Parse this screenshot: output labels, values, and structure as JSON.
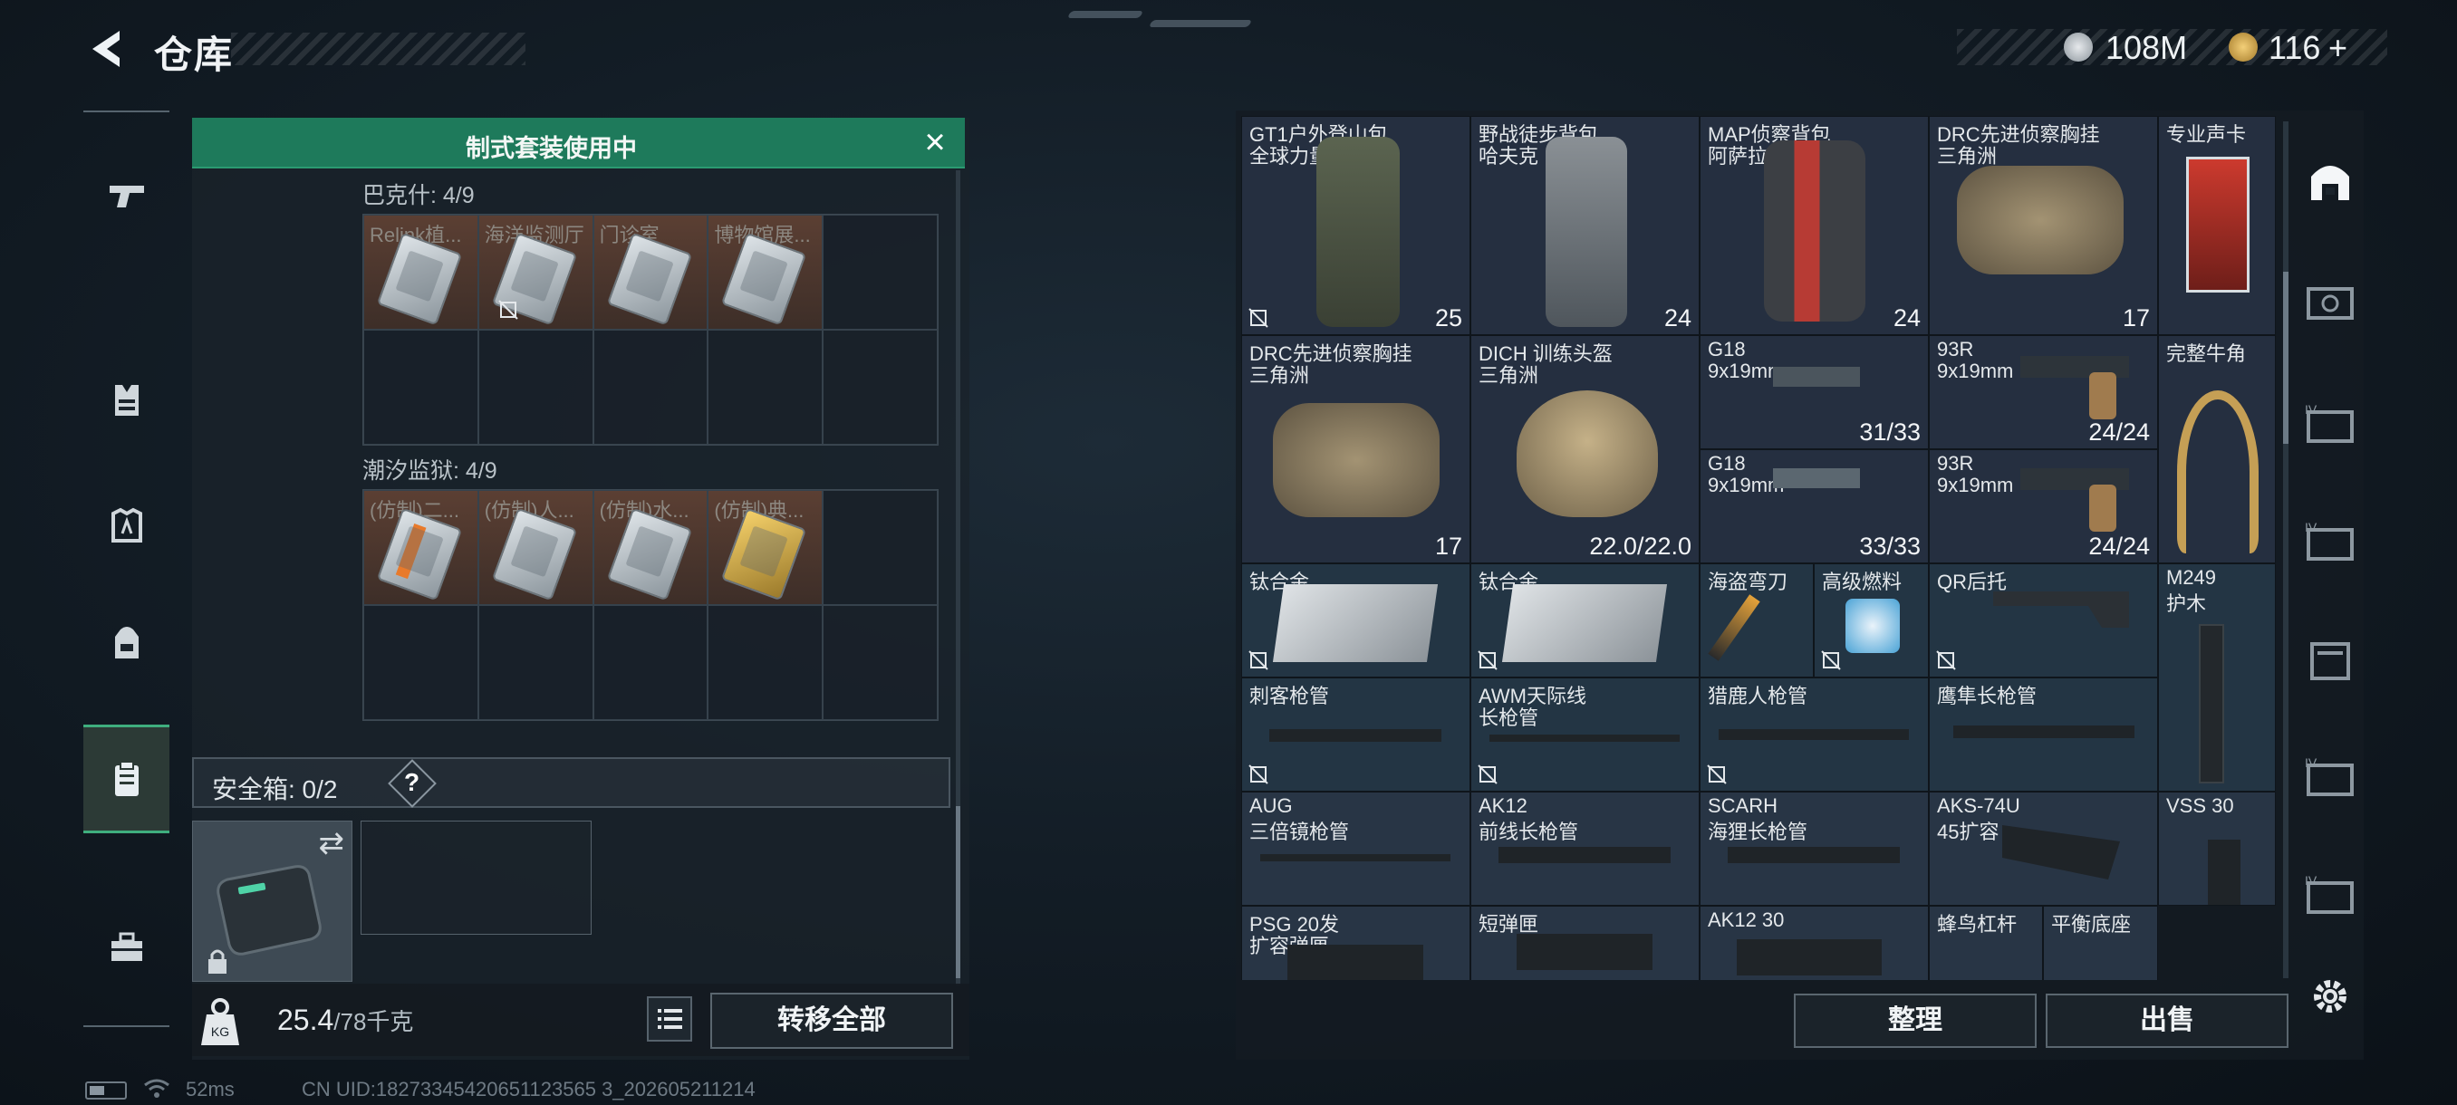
{
  "header": {
    "back_glyph": "‹",
    "title": "仓库"
  },
  "currency": {
    "silver_amount": "108M",
    "gold_amount": "116",
    "plus": "+",
    "silver_color": "#c7cbd0",
    "gold_color": "#d6a64a"
  },
  "sidebar": {
    "items": [
      {
        "name": "pistol-icon",
        "active": false
      },
      {
        "name": "vest-icon",
        "active": false
      },
      {
        "name": "armor-plate-icon",
        "active": false
      },
      {
        "name": "backpack-icon",
        "active": false
      },
      {
        "name": "clipboard-icon",
        "active": true
      },
      {
        "name": "toolbox-icon",
        "active": false
      }
    ]
  },
  "loadout": {
    "banner": "制式套装使用中",
    "close_glyph": "×",
    "section1": {
      "label": "巴克什: 4/9",
      "cells": [
        "Relink植...",
        "海洋监测厅",
        "门诊室",
        "博物馆展..."
      ]
    },
    "section2": {
      "label": "潮汐监狱: 4/9",
      "cells": [
        "(仿制)二...",
        "(仿制)人...",
        "(仿制)水...",
        "(仿制)典..."
      ]
    },
    "safebox_label": "安全箱:  0/2",
    "safebox_help": "?",
    "swap_glyph": "⇄",
    "weight_value": "25.4",
    "weight_max": "/78千克",
    "transfer_button": "转移全部"
  },
  "storage": {
    "items": [
      {
        "name1": "GT1户外登山包",
        "name2": "全球力量",
        "count": "25"
      },
      {
        "name1": "野战徒步背包",
        "name2": "哈夫克",
        "count": "24"
      },
      {
        "name1": "MAP侦察背包",
        "name2": "阿萨拉",
        "count": "24"
      },
      {
        "name1": "DRC先进侦察胸挂",
        "name2": "三角洲",
        "count": "17"
      },
      {
        "name1": "专业声卡",
        "name2": "",
        "count": ""
      },
      {
        "name1": "DRC先进侦察胸挂",
        "name2": "三角洲",
        "count": "17"
      },
      {
        "name1": "DICH 训练头盔",
        "name2": "三角洲",
        "count": "22.0/22.0"
      },
      {
        "name1": "G18",
        "name2": "9x19mm",
        "count": "31/33"
      },
      {
        "name1": "93R",
        "name2": "9x19mm",
        "count": "24/24"
      },
      {
        "name1": "完整牛角",
        "name2": "",
        "count": ""
      },
      {
        "name1": "G18",
        "name2": "9x19mm",
        "count": "33/33"
      },
      {
        "name1": "93R",
        "name2": "9x19mm",
        "count": "24/24"
      },
      {
        "name1": "钛合金",
        "name2": "",
        "count": ""
      },
      {
        "name1": "钛合金",
        "name2": "",
        "count": ""
      },
      {
        "name1": "海盗弯刀",
        "name2": "",
        "count": ""
      },
      {
        "name1": "高级燃料",
        "name2": "",
        "count": ""
      },
      {
        "name1": "QR后托",
        "name2": "",
        "count": ""
      },
      {
        "name1": "M249",
        "name2": "护木",
        "count": ""
      },
      {
        "name1": "刺客枪管",
        "name2": "",
        "count": ""
      },
      {
        "name1": "AWM天际线",
        "name2": "长枪管",
        "count": ""
      },
      {
        "name1": "猎鹿人枪管",
        "name2": "",
        "count": ""
      },
      {
        "name1": "鹰隼长枪管",
        "name2": "",
        "count": ""
      },
      {
        "name1": "AUG",
        "name2": "三倍镜枪管",
        "count": ""
      },
      {
        "name1": "AK12",
        "name2": "前线长枪管",
        "count": ""
      },
      {
        "name1": "SCARH",
        "name2": "海狸长枪管",
        "count": ""
      },
      {
        "name1": "AKS-74U",
        "name2": "45扩容",
        "count": ""
      },
      {
        "name1": "VSS 30",
        "name2": "",
        "count": ""
      },
      {
        "name1": "PSG 20发",
        "name2": "扩容弹匣",
        "count": ""
      },
      {
        "name1": "短弹匣",
        "name2": "",
        "count": ""
      },
      {
        "name1": "AK12 30",
        "name2": "",
        "count": ""
      },
      {
        "name1": "蜂鸟杠杆",
        "name2": "",
        "count": ""
      },
      {
        "name1": "平衡底座",
        "name2": "",
        "count": ""
      }
    ],
    "sort_button": "整理",
    "sell_button": "出售"
  },
  "right_sidebar": [
    {
      "name": "home-vault-icon"
    },
    {
      "name": "storage-tab-icon",
      "roman": ""
    },
    {
      "name": "storage-tab-icon",
      "roman": "IV"
    },
    {
      "name": "storage-tab-icon",
      "roman": "IV"
    },
    {
      "name": "storage-tab-icon",
      "roman": ""
    },
    {
      "name": "storage-tab-icon",
      "roman": "IV"
    },
    {
      "name": "storage-tab-icon",
      "roman": "IV"
    }
  ],
  "status": {
    "ping": "52ms",
    "uid": "CN UID:18273345420651123565 3_202605211214"
  }
}
